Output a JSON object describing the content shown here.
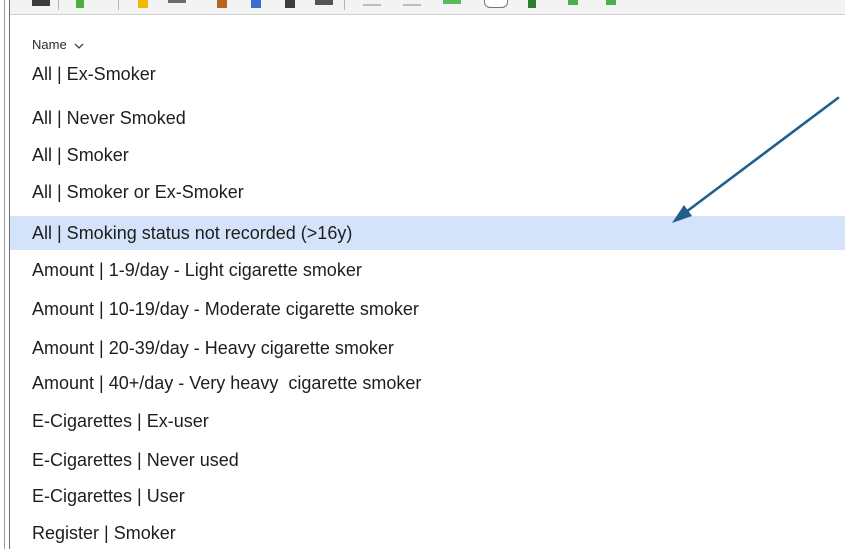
{
  "list": {
    "header_label": "Name",
    "items": [
      "All | Ex-Smoker",
      "All | Never Smoked",
      "All | Smoker",
      "All | Smoker or Ex-Smoker",
      "All | Smoking status not recorded (>16y)",
      "Amount | 1-9/day - Light cigarette smoker",
      "Amount | 10-19/day - Moderate cigarette smoker",
      "Amount | 20-39/day - Heavy cigarette smoker",
      "Amount | 40+/day - Very heavy  cigarette smoker",
      "E-Cigarettes | Ex-user",
      "E-Cigarettes | Never used",
      "E-Cigarettes | User",
      "Register | Smoker"
    ],
    "selected_index": 4
  },
  "colors": {
    "selection": "#d4e3fa",
    "arrow": "#1f5f8a"
  },
  "icons": {
    "header_sort": "chevron-down-icon",
    "annotation": "annotation-arrow-icon"
  }
}
